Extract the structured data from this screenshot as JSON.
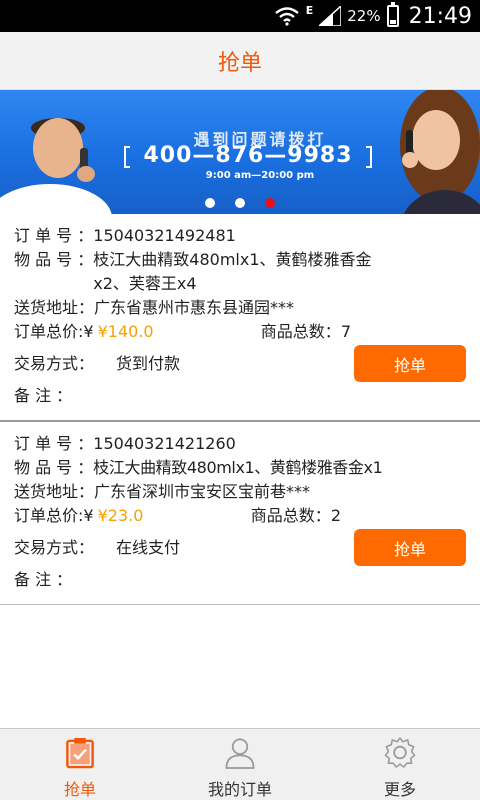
{
  "status_bar": {
    "network_type": "E",
    "battery_percent": "22%",
    "battery_level": 0.22,
    "time": "21:49",
    "icons": [
      "wifi-icon",
      "signal-icon",
      "battery-icon"
    ]
  },
  "header": {
    "title": "抢单"
  },
  "banner": {
    "headline": "遇到问题请拨打",
    "phone": "400—876—9983",
    "hours": "9:00 am—20:00 pm",
    "slides_total": 3,
    "active_slide": 3
  },
  "labels": {
    "order_no": "订 单 号",
    "item_no": "物 品 号",
    "address": "送货地址",
    "total_price": "订单总价",
    "item_count": "商品总数",
    "payment": "交易方式",
    "note": "备 注",
    "currency": "¥",
    "grab_button": "抢单"
  },
  "orders": [
    {
      "order_no": "15040321492481",
      "items": "枝江大曲精致480mlx1、黄鹤楼雅香金x2、芙蓉王x4",
      "address": "广东省惠州市惠东县通园***",
      "total_price": "¥140.0",
      "item_count": "7",
      "payment": "货到付款",
      "note": ""
    },
    {
      "order_no": "15040321421260",
      "items": "枝江大曲精致480mlx1、黄鹤楼雅香金x1",
      "address": "广东省深圳市宝安区宝前巷***",
      "total_price": "¥23.0",
      "item_count": "2",
      "payment": "在线支付",
      "note": ""
    }
  ],
  "bottom_nav": [
    {
      "label": "抢单",
      "icon": "clipboard-icon",
      "active": true
    },
    {
      "label": "我的订单",
      "icon": "user-icon",
      "active": false
    },
    {
      "label": "更多",
      "icon": "gear-icon",
      "active": false
    }
  ],
  "colors": {
    "accent": "#f05a0a",
    "button": "#ff6a00",
    "price": "#f5a100",
    "banner_blue": "#2f86f0",
    "active_dot": "#e8101a"
  }
}
